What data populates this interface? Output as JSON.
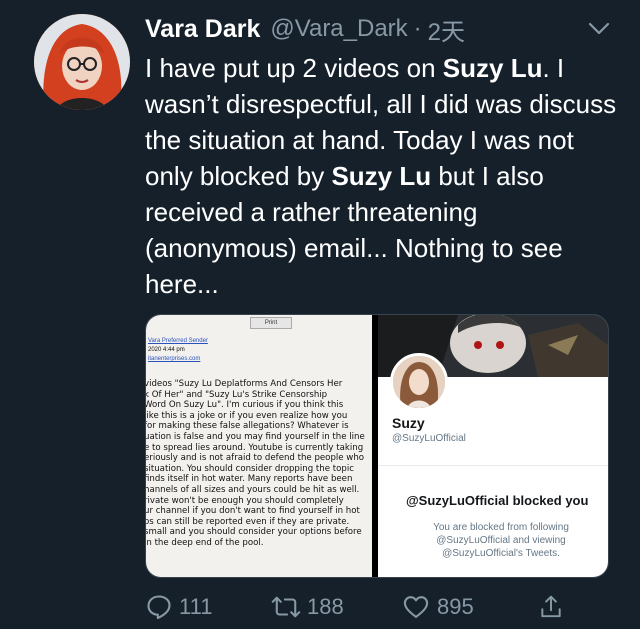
{
  "tweet": {
    "author_name": "Vara Dark",
    "author_handle": "@Vara_Dark",
    "separator": "·",
    "time": "2天",
    "text_parts": [
      {
        "t": "I have put up 2 videos on ",
        "b": false
      },
      {
        "t": "Suzy Lu",
        "b": true
      },
      {
        "t": ". I wasn’t disrespectful, all I did was discuss the situation at hand. Today I was not only blocked by ",
        "b": false
      },
      {
        "t": "Suzy Lu",
        "b": true
      },
      {
        "t": " but I also received a rather threatening (anonymous) email... Nothing to see here...",
        "b": false
      }
    ]
  },
  "media": {
    "email": {
      "print_label": "Print",
      "meta_line1": "Vara  Preferred Sender",
      "meta_line2": "2020 4:44 pm",
      "meta_link": "itanenterprises.com",
      "body_lines": [
        "videos \"Suzy Lu Deplatforms And Censors Her",
        "k Of Her\" and \"Suzy Lu's Strike Censorship",
        "Word On Suzy Lu\". I'm curious if you think this",
        "like this is a joke or if you even realize how you",
        "for making these false allegations? Whatever is",
        "uation is false and you may find yourself in the line",
        "e to spread lies around. Youtube is currently taking",
        "eriously and is not afraid to defend the people who",
        "situation. You should consider dropping the topic",
        "finds itself in hot water. Many reports have been",
        "hannels of all sizes and yours could be hit as well.",
        "rivate won't be enough you should completely",
        "ur channel if you don't want to find yourself in hot",
        "os can still be reported even if they are private.",
        "small and you should consider your options before",
        "in the deep end of the pool."
      ]
    },
    "profile": {
      "name": "Suzy",
      "handle": "@SuzyLuOfficial",
      "blocked_title": "@SuzyLuOfficial blocked you",
      "blocked_message": "You are blocked from following @SuzyLuOfficial and viewing @SuzyLuOfficial's Tweets."
    }
  },
  "actions": {
    "reply_count": "111",
    "retweet_count": "188",
    "like_count": "895"
  },
  "colors": {
    "background": "#15202b",
    "secondary_text": "#8899a6",
    "link": "#1da1f2"
  }
}
